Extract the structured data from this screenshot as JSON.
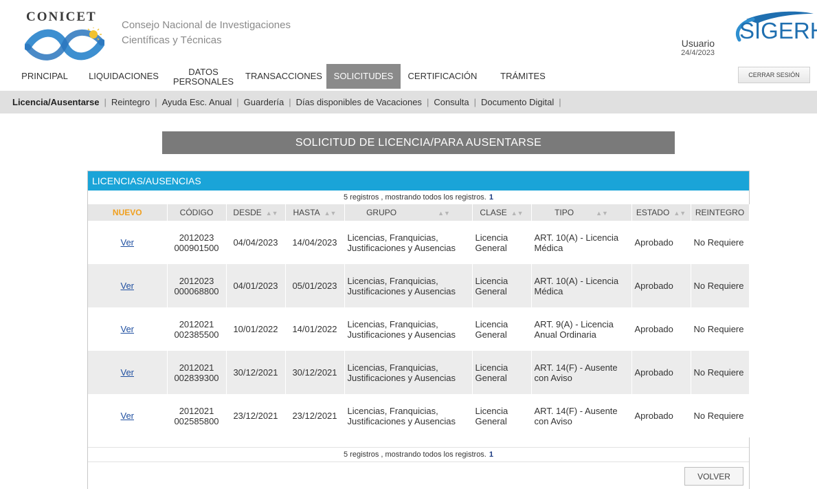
{
  "header": {
    "brand": "CONICET",
    "org_line1": "Consejo Nacional de Investigaciones",
    "org_line2": "Científicas y Técnicas",
    "user_label": "Usuario",
    "date": "24/4/2023",
    "sigerh": "SIGERH",
    "colors": {
      "brand_blue": "#1f6fb0",
      "accent": "#1aa4d8"
    }
  },
  "nav": {
    "items": [
      {
        "label": "PRINCIPAL"
      },
      {
        "label": "LIQUIDACIONES"
      },
      {
        "label": "DATOS PERSONALES"
      },
      {
        "label": "TRANSACCIONES"
      },
      {
        "label": "SOLICITUDES",
        "active": true
      },
      {
        "label": "CERTIFICACIÓN"
      },
      {
        "label": "TRÁMITES"
      }
    ],
    "logout": "CERRAR SESIÓN"
  },
  "subnav": {
    "items": [
      {
        "label": "Licencia/Ausentarse",
        "active": true
      },
      {
        "label": "Reintegro"
      },
      {
        "label": "Ayuda Esc. Anual"
      },
      {
        "label": "Guardería"
      },
      {
        "label": "Días disponibles de Vacaciones"
      },
      {
        "label": "Consulta"
      },
      {
        "label": "Documento Digital"
      }
    ]
  },
  "page": {
    "title": "SOLICITUD DE LICENCIA/PARA AUSENTARSE"
  },
  "panel": {
    "title": "LICENCIAS/AUSENCIAS",
    "records_text": "5 registros , mostrando todos los registros.",
    "records_page": "1",
    "columns": [
      "NUEVO",
      "CÓDIGO",
      "DESDE",
      "HASTA",
      "GRUPO",
      "CLASE",
      "TIPO",
      "ESTADO",
      "REINTEGRO"
    ],
    "rows": [
      {
        "ver": "Ver",
        "code1": "2012023",
        "code2": "000901500",
        "desde": "04/04/2023",
        "hasta": "14/04/2023",
        "grupo": "Licencias, Franquicias, Justificaciones y Ausencias",
        "clase": "Licencia General",
        "tipo": "ART. 10(A) - Licencia Médica",
        "estado": "Aprobado",
        "reintegro": "No Requiere"
      },
      {
        "ver": "Ver",
        "code1": "2012023",
        "code2": "000068800",
        "desde": "04/01/2023",
        "hasta": "05/01/2023",
        "grupo": "Licencias, Franquicias, Justificaciones y Ausencias",
        "clase": "Licencia General",
        "tipo": "ART. 10(A) - Licencia Médica",
        "estado": "Aprobado",
        "reintegro": "No Requiere"
      },
      {
        "ver": "Ver",
        "code1": "2012021",
        "code2": "002385500",
        "desde": "10/01/2022",
        "hasta": "14/01/2022",
        "grupo": "Licencias, Franquicias, Justificaciones y Ausencias",
        "clase": "Licencia General",
        "tipo": "ART. 9(A) - Licencia Anual Ordinaria",
        "estado": "Aprobado",
        "reintegro": "No Requiere"
      },
      {
        "ver": "Ver",
        "code1": "2012021",
        "code2": "002839300",
        "desde": "30/12/2021",
        "hasta": "30/12/2021",
        "grupo": "Licencias, Franquicias, Justificaciones y Ausencias",
        "clase": "Licencia General",
        "tipo": "ART. 14(F) - Ausente con Aviso",
        "estado": "Aprobado",
        "reintegro": "No Requiere"
      },
      {
        "ver": "Ver",
        "code1": "2012021",
        "code2": "002585800",
        "desde": "23/12/2021",
        "hasta": "23/12/2021",
        "grupo": "Licencias, Franquicias, Justificaciones y Ausencias",
        "clase": "Licencia General",
        "tipo": "ART. 14(F) - Ausente con Aviso",
        "estado": "Aprobado",
        "reintegro": "No Requiere"
      }
    ],
    "back_button": "VOLVER"
  }
}
